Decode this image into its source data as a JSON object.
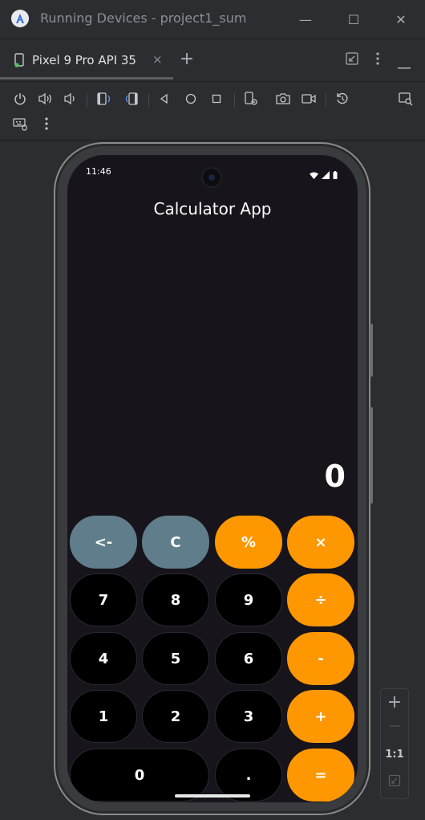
{
  "window": {
    "title": "Running Devices - project1_sum",
    "controls": {
      "minimize": "—",
      "maximize": "☐",
      "close": "✕"
    }
  },
  "tabs": [
    {
      "label": "Pixel 9 Pro API 35",
      "close": "×"
    }
  ],
  "tab_add": "+",
  "icons": {
    "logo": "android-studio-logo",
    "toolbar": [
      "power-icon",
      "volume-up-icon",
      "volume-down-icon",
      "rotate-left-icon",
      "rotate-right-icon",
      "back-icon",
      "home-icon",
      "overview-icon",
      "device-settings-icon",
      "screenshot-icon",
      "screen-record-icon",
      "reset-icon",
      "search-window-icon",
      "keyboard-icon",
      "more-icon"
    ]
  },
  "device": {
    "status_time": "11:46",
    "app_title": "Calculator App",
    "display_value": "0",
    "keys": [
      {
        "label": "<-",
        "style": "gray"
      },
      {
        "label": "C",
        "style": "gray"
      },
      {
        "label": "%",
        "style": "orange"
      },
      {
        "label": "×",
        "style": "orange"
      },
      {
        "label": "7",
        "style": "dark"
      },
      {
        "label": "8",
        "style": "dark"
      },
      {
        "label": "9",
        "style": "dark"
      },
      {
        "label": "÷",
        "style": "orange"
      },
      {
        "label": "4",
        "style": "dark"
      },
      {
        "label": "5",
        "style": "dark"
      },
      {
        "label": "6",
        "style": "dark"
      },
      {
        "label": "-",
        "style": "orange"
      },
      {
        "label": "1",
        "style": "dark"
      },
      {
        "label": "2",
        "style": "dark"
      },
      {
        "label": "3",
        "style": "dark"
      },
      {
        "label": "+",
        "style": "orange"
      },
      {
        "label": "0",
        "style": "dark"
      },
      {
        "label": ".",
        "style": "dark"
      },
      {
        "label": "=",
        "style": "orange"
      }
    ]
  },
  "zoom": {
    "in": "+",
    "out": "—",
    "actual": "1:1"
  },
  "colors": {
    "orange": "#ff9800",
    "gray": "#607d8b",
    "screen_bg": "#17141b",
    "ide_bg": "#2b2d30"
  }
}
